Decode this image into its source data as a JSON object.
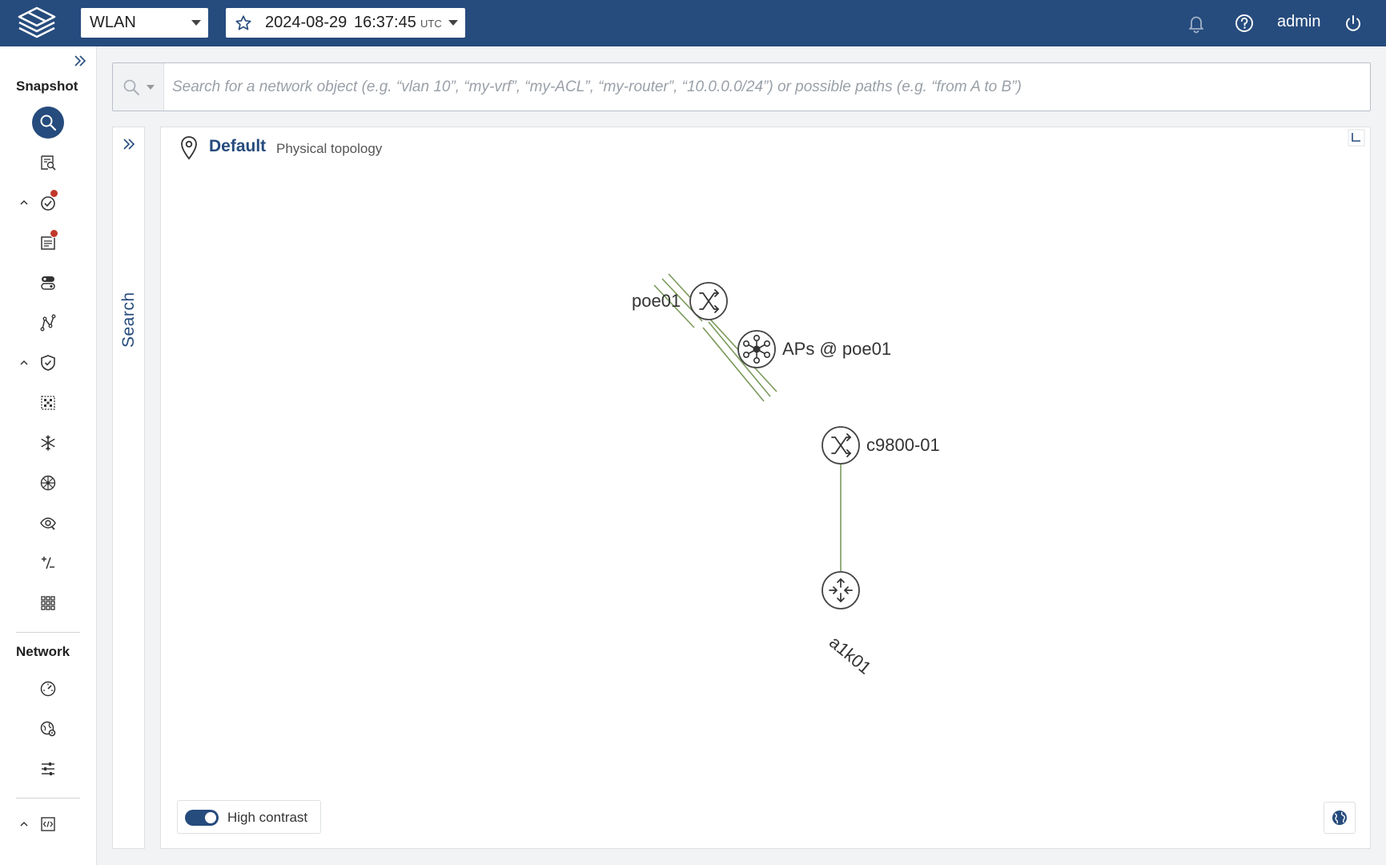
{
  "header": {
    "network_select": "WLAN",
    "snapshot": {
      "date": "2024-08-29",
      "time": "16:37:45",
      "tz": "UTC"
    },
    "user": "admin"
  },
  "sidebar": {
    "snapshot_heading": "Snapshot",
    "network_heading": "Network",
    "items": [
      "search-icon",
      "inventory-search-icon",
      "verification-icon",
      "intent-checks-icon",
      "devices-icon",
      "topology-path-icon",
      "security-shield-icon",
      "matrix-icon",
      "snowflake-icon",
      "hub-icon",
      "visibility-icon",
      "plus-minus-icon",
      "apps-grid-icon",
      "dashboard-gauge-icon",
      "collection-settings-icon",
      "settings-sliders-icon",
      "code-icon"
    ]
  },
  "search": {
    "placeholder": "Search for a network object (e.g. “vlan 10”, “my-vrf”, “my-ACL”, “my-router”, “10.0.0.0/24”) or possible paths (e.g. “from A to B”)",
    "value": ""
  },
  "drawer": {
    "label": "Search"
  },
  "topology": {
    "title": "Default",
    "subtitle": "Physical topology",
    "nodes": [
      {
        "id": "poe01",
        "label": "poe01",
        "type": "switch"
      },
      {
        "id": "aps",
        "label": "APs @ poe01",
        "type": "ap-group"
      },
      {
        "id": "c9800",
        "label": "c9800-01",
        "type": "switch"
      },
      {
        "id": "a1k01",
        "label": "a1k01",
        "type": "router"
      }
    ],
    "links": [
      [
        "poe01",
        "aps"
      ],
      [
        "poe01",
        "aps"
      ],
      [
        "aps",
        "c9800"
      ],
      [
        "aps",
        "c9800"
      ],
      [
        "poe01",
        "c9800"
      ],
      [
        "c9800",
        "a1k01"
      ]
    ],
    "link_color": "#7a9a5a",
    "high_contrast": {
      "label": "High contrast",
      "enabled": true
    }
  },
  "colors": {
    "brand": "#264b7d",
    "alert": "#c0392b"
  }
}
